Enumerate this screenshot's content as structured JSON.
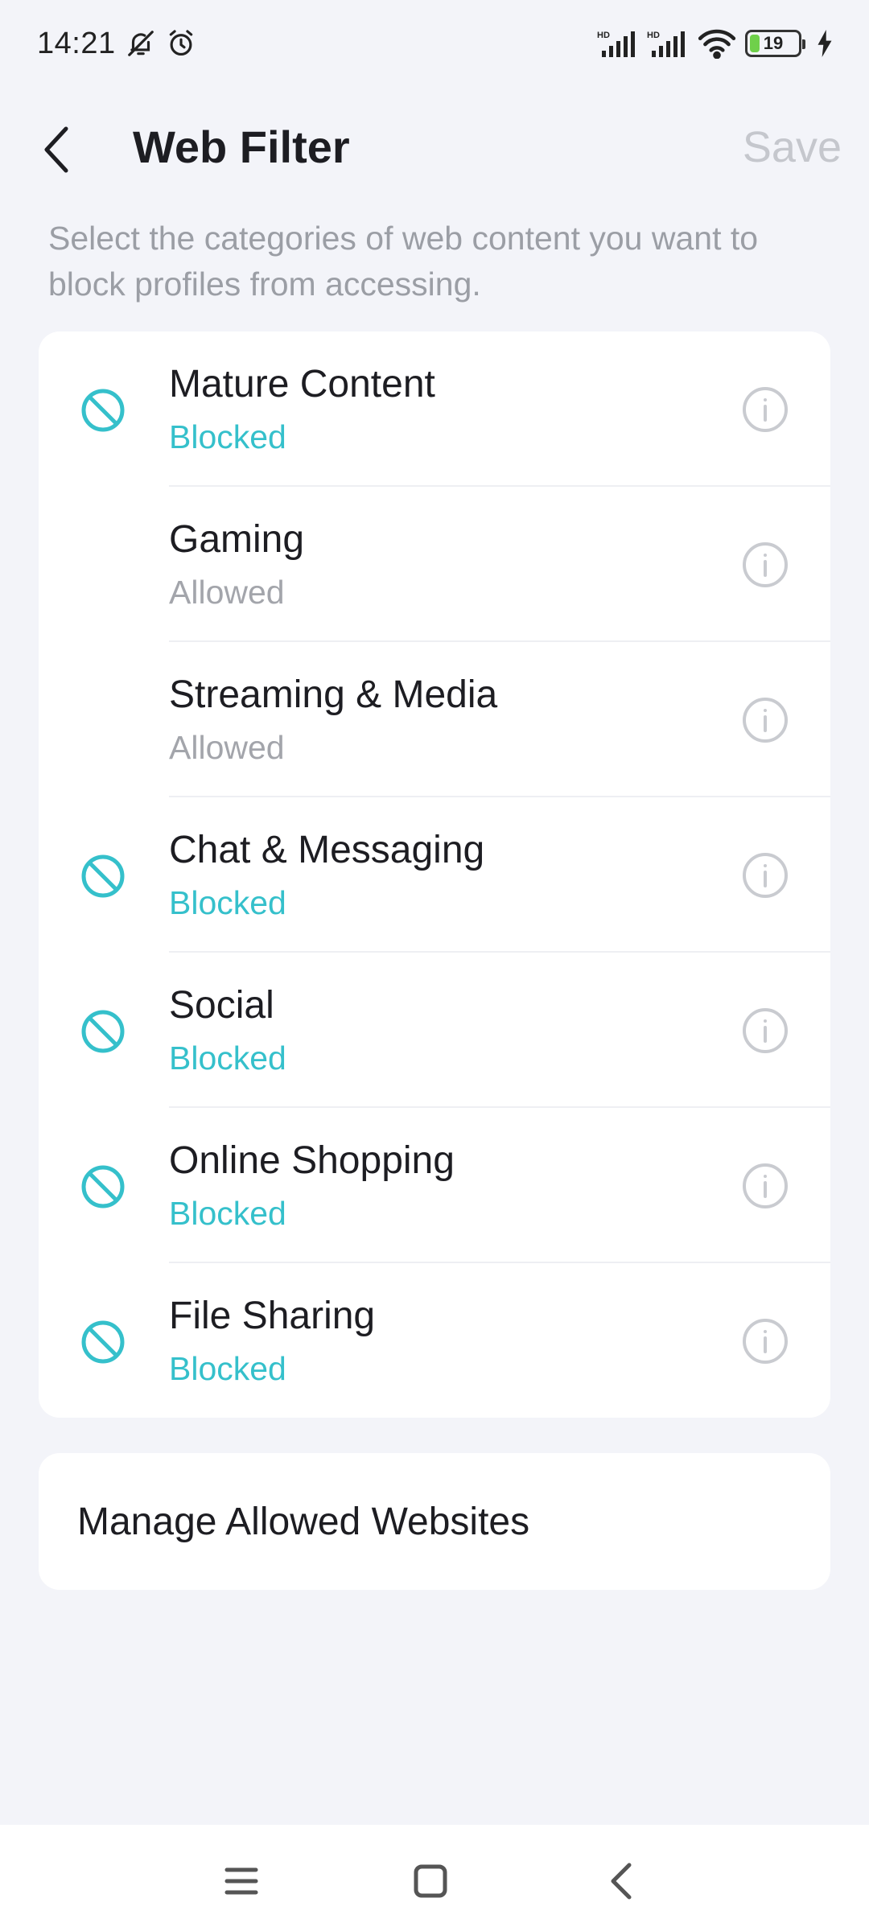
{
  "status_bar": {
    "time": "14:21",
    "battery_level": "19",
    "icons": [
      "bell-off-icon",
      "alarm-icon",
      "hd-signal-icon",
      "hd-signal-icon",
      "wifi-icon",
      "battery-icon",
      "charging-icon"
    ]
  },
  "header": {
    "title": "Web Filter",
    "save_label": "Save"
  },
  "description": "Select the categories of web content you want to block profiles from accessing.",
  "categories": [
    {
      "title": "Mature Content",
      "status": "Blocked",
      "blocked": true
    },
    {
      "title": "Gaming",
      "status": "Allowed",
      "blocked": false
    },
    {
      "title": "Streaming & Media",
      "status": "Allowed",
      "blocked": false
    },
    {
      "title": "Chat & Messaging",
      "status": "Blocked",
      "blocked": true
    },
    {
      "title": "Social",
      "status": "Blocked",
      "blocked": true
    },
    {
      "title": "Online Shopping",
      "status": "Blocked",
      "blocked": true
    },
    {
      "title": "File Sharing",
      "status": "Blocked",
      "blocked": true
    }
  ],
  "manage": {
    "label": "Manage Allowed Websites"
  },
  "colors": {
    "accent": "#35c0cb",
    "allowed": "#a3a5ab",
    "background": "#f3f4f9"
  },
  "nav_bar": {
    "icons": [
      "menu-icon",
      "home-square-icon",
      "back-triangle-icon"
    ]
  }
}
